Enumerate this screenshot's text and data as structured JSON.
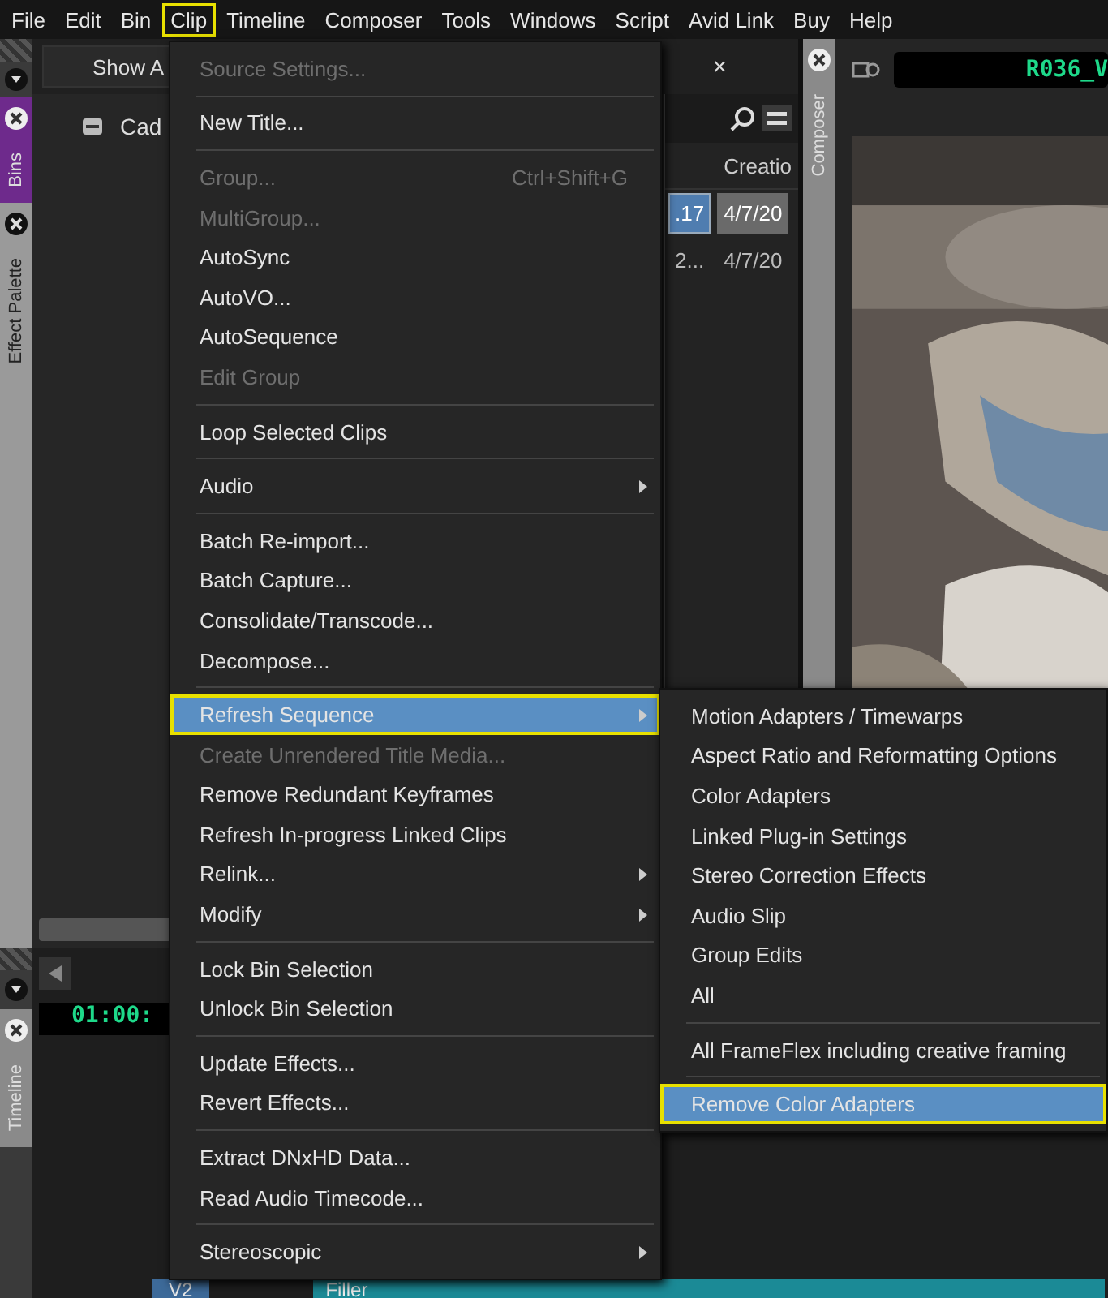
{
  "menubar": [
    {
      "label": "File",
      "selected": false
    },
    {
      "label": "Edit",
      "selected": false
    },
    {
      "label": "Bin",
      "selected": false
    },
    {
      "label": "Clip",
      "selected": true
    },
    {
      "label": "Timeline",
      "selected": false
    },
    {
      "label": "Composer",
      "selected": false
    },
    {
      "label": "Tools",
      "selected": false
    },
    {
      "label": "Windows",
      "selected": false
    },
    {
      "label": "Script",
      "selected": false
    },
    {
      "label": "Avid Link",
      "selected": false
    },
    {
      "label": "Buy",
      "selected": false
    },
    {
      "label": "Help",
      "selected": false
    }
  ],
  "side_tabs": [
    {
      "label": "Bins",
      "color": "#6e2a8c"
    },
    {
      "label": "Effect Palette",
      "color": "#9a9a9a"
    }
  ],
  "bin": {
    "show_button": "Show A",
    "tab_close": "×",
    "bin_item": "Cad",
    "column_header": "Creatio",
    "rows": [
      {
        "cells": [
          ".17",
          "4/7/20"
        ],
        "selected": true
      },
      {
        "cells": [
          "2...",
          "4/7/20"
        ],
        "selected": false
      }
    ]
  },
  "composer": {
    "tab": "Composer",
    "timecode": "R036_V"
  },
  "timeline": {
    "tab": "Timeline",
    "timecode": "01:00:",
    "track": "V2",
    "clip": "Filler"
  },
  "clip_menu": [
    {
      "kind": "item",
      "label": "Source Settings...",
      "disabled": true
    },
    {
      "kind": "separator"
    },
    {
      "kind": "item",
      "label": "New Title...",
      "disabled": false
    },
    {
      "kind": "separator"
    },
    {
      "kind": "item",
      "label": "Group...",
      "shortcut": "Ctrl+Shift+G",
      "disabled": true
    },
    {
      "kind": "item",
      "label": "MultiGroup...",
      "disabled": true
    },
    {
      "kind": "item",
      "label": "AutoSync",
      "disabled": false
    },
    {
      "kind": "item",
      "label": "AutoVO...",
      "disabled": false
    },
    {
      "kind": "item",
      "label": "AutoSequence",
      "disabled": false
    },
    {
      "kind": "item",
      "label": "Edit Group",
      "disabled": true
    },
    {
      "kind": "separator"
    },
    {
      "kind": "item",
      "label": "Loop Selected Clips",
      "disabled": false
    },
    {
      "kind": "separator"
    },
    {
      "kind": "item",
      "label": "Audio",
      "disabled": false,
      "submenu": true
    },
    {
      "kind": "separator"
    },
    {
      "kind": "item",
      "label": "Batch Re-import...",
      "disabled": false
    },
    {
      "kind": "item",
      "label": "Batch Capture...",
      "disabled": false
    },
    {
      "kind": "item",
      "label": "Consolidate/Transcode...",
      "disabled": false
    },
    {
      "kind": "item",
      "label": "Decompose...",
      "disabled": false
    },
    {
      "kind": "separator"
    },
    {
      "kind": "item",
      "label": "Refresh Sequence",
      "disabled": false,
      "submenu": true,
      "selected": true
    },
    {
      "kind": "item",
      "label": "Create Unrendered Title Media...",
      "disabled": true
    },
    {
      "kind": "item",
      "label": "Remove Redundant Keyframes",
      "disabled": false
    },
    {
      "kind": "item",
      "label": "Refresh In-progress Linked Clips",
      "disabled": false
    },
    {
      "kind": "item",
      "label": "Relink...",
      "disabled": false,
      "submenu": true
    },
    {
      "kind": "item",
      "label": "Modify",
      "disabled": false,
      "submenu": true
    },
    {
      "kind": "separator"
    },
    {
      "kind": "item",
      "label": "Lock Bin Selection",
      "disabled": false
    },
    {
      "kind": "item",
      "label": "Unlock Bin Selection",
      "disabled": false
    },
    {
      "kind": "separator"
    },
    {
      "kind": "item",
      "label": "Update Effects...",
      "disabled": false
    },
    {
      "kind": "item",
      "label": "Revert Effects...",
      "disabled": false
    },
    {
      "kind": "separator"
    },
    {
      "kind": "item",
      "label": "Extract DNxHD Data...",
      "disabled": false
    },
    {
      "kind": "item",
      "label": "Read Audio Timecode...",
      "disabled": false
    },
    {
      "kind": "separator"
    },
    {
      "kind": "item",
      "label": "Stereoscopic",
      "disabled": false,
      "submenu": true
    }
  ],
  "refresh_submenu": [
    {
      "kind": "item",
      "label": "Motion Adapters / Timewarps",
      "selected": false
    },
    {
      "kind": "item",
      "label": "Aspect Ratio and Reformatting Options",
      "selected": false
    },
    {
      "kind": "item",
      "label": "Color Adapters",
      "selected": false
    },
    {
      "kind": "item",
      "label": "Linked Plug-in Settings",
      "selected": false
    },
    {
      "kind": "item",
      "label": "Stereo Correction Effects",
      "selected": false
    },
    {
      "kind": "item",
      "label": "Audio Slip",
      "selected": false
    },
    {
      "kind": "item",
      "label": "Group Edits",
      "selected": false
    },
    {
      "kind": "item",
      "label": "All",
      "selected": false
    },
    {
      "kind": "separator"
    },
    {
      "kind": "item",
      "label": "All FrameFlex including creative framing",
      "selected": false
    },
    {
      "kind": "separator"
    },
    {
      "kind": "item",
      "label": "Remove Color Adapters",
      "selected": true
    }
  ]
}
